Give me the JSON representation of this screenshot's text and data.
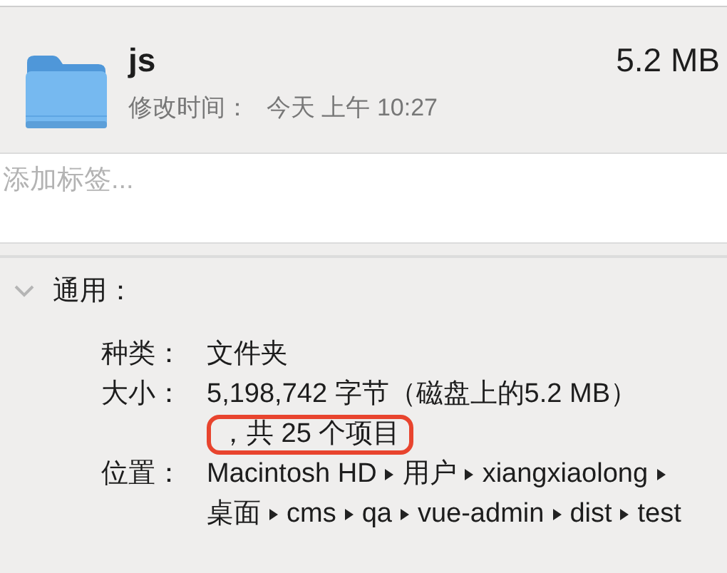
{
  "header": {
    "name": "js",
    "size": "5.2 MB",
    "modified_label": "修改时间：",
    "modified_value": "今天 上午 10:27"
  },
  "tags_field": {
    "placeholder": "添加标签..."
  },
  "general": {
    "title": "通用：",
    "expanded": true,
    "rows": [
      {
        "kind": "text",
        "label": "种类：",
        "segments": [
          {
            "text": "文件夹",
            "highlighted": false
          }
        ]
      },
      {
        "kind": "text",
        "label": "大小：",
        "segments": [
          {
            "text": "5,198,742 字节（磁盘上的5.2 MB）",
            "highlighted": false
          },
          {
            "text": "，共 25 个项目",
            "highlighted": true
          }
        ]
      },
      {
        "kind": "path",
        "label": "位置：",
        "path": [
          "Macintosh HD",
          "用户",
          "xiangxiaolong",
          "桌面",
          "cms",
          "qa",
          "vue-admin",
          "dist",
          "test"
        ]
      }
    ]
  }
}
